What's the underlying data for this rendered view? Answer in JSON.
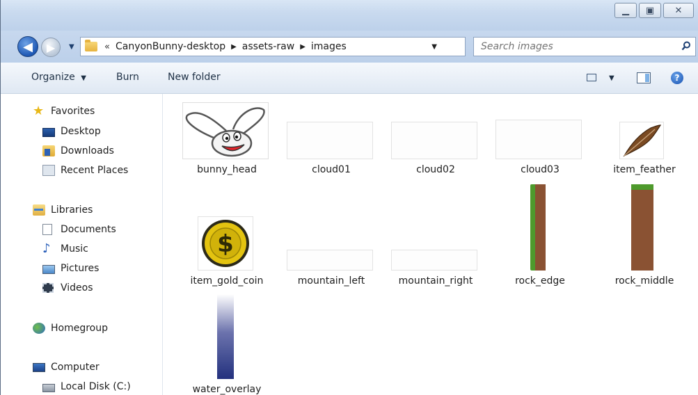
{
  "address": {
    "crumbs": [
      "CanyonBunny-desktop",
      "assets-raw",
      "images"
    ],
    "overflow": "«"
  },
  "search": {
    "placeholder": "Search images"
  },
  "commands": {
    "organize": "Organize",
    "burn": "Burn",
    "new_folder": "New folder"
  },
  "nav": {
    "favorites": "Favorites",
    "desktop": "Desktop",
    "downloads": "Downloads",
    "recent": "Recent Places",
    "libraries": "Libraries",
    "documents": "Documents",
    "music": "Music",
    "pictures": "Pictures",
    "videos": "Videos",
    "homegroup": "Homegroup",
    "computer": "Computer",
    "local_disk": "Local Disk (C:)"
  },
  "files": {
    "bunny_head": "bunny_head",
    "cloud01": "cloud01",
    "cloud02": "cloud02",
    "cloud03": "cloud03",
    "item_feather": "item_feather",
    "item_gold_coin": "item_gold_coin",
    "mountain_left": "mountain_left",
    "mountain_right": "mountain_right",
    "rock_edge": "rock_edge",
    "rock_middle": "rock_middle",
    "water_overlay": "water_overlay"
  },
  "colors": {
    "rock_brown": "#8a5233",
    "grass_green": "#4e9a2c",
    "coin_gold": "#e3c310",
    "water_blue": "#23317e"
  }
}
